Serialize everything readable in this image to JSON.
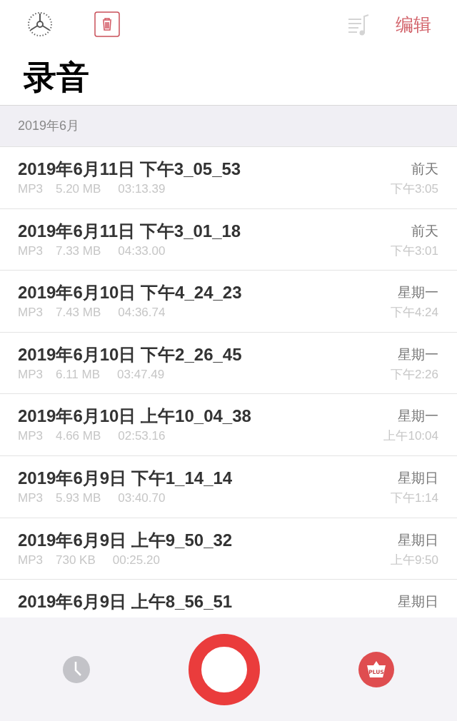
{
  "toolbar": {
    "edit_label": "编辑"
  },
  "title": "录音",
  "section": "2019年6月",
  "recordings": [
    {
      "name": "2019年6月11日 下午3_05_53",
      "format": "MP3",
      "size": "5.20 MB",
      "duration": "03:13.39",
      "day": "前天",
      "time": "下午3:05"
    },
    {
      "name": "2019年6月11日 下午3_01_18",
      "format": "MP3",
      "size": "7.33 MB",
      "duration": "04:33.00",
      "day": "前天",
      "time": "下午3:01"
    },
    {
      "name": "2019年6月10日 下午4_24_23",
      "format": "MP3",
      "size": "7.43 MB",
      "duration": "04:36.74",
      "day": "星期一",
      "time": "下午4:24"
    },
    {
      "name": "2019年6月10日 下午2_26_45",
      "format": "MP3",
      "size": "6.11 MB",
      "duration": "03:47.49",
      "day": "星期一",
      "time": "下午2:26"
    },
    {
      "name": "2019年6月10日 上午10_04_38",
      "format": "MP3",
      "size": "4.66 MB",
      "duration": "02:53.16",
      "day": "星期一",
      "time": "上午10:04"
    },
    {
      "name": "2019年6月9日 下午1_14_14",
      "format": "MP3",
      "size": "5.93 MB",
      "duration": "03:40.70",
      "day": "星期日",
      "time": "下午1:14"
    },
    {
      "name": "2019年6月9日 上午9_50_32",
      "format": "MP3",
      "size": "730 KB",
      "duration": "00:25.20",
      "day": "星期日",
      "time": "上午9:50"
    },
    {
      "name": "2019年6月9日 上午8_56_51",
      "day": "星期日"
    }
  ],
  "bottom_bar": {
    "plus_label": "PLUS"
  }
}
